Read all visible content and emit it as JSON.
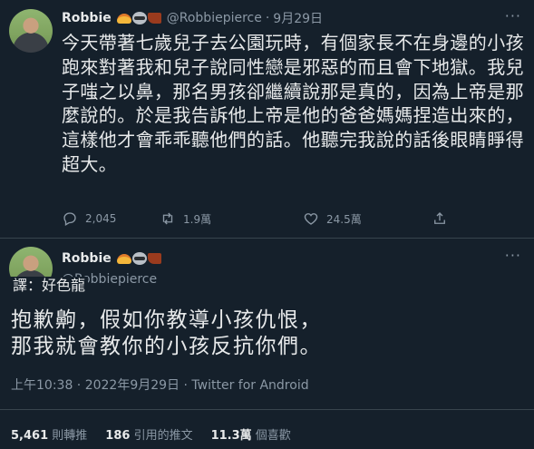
{
  "tweet": {
    "name": "Robbie",
    "handle": "@Robbiepierce",
    "date": "9月29日",
    "text": "今天帶著七歲兒子去公園玩時，有個家長不在身邊的小孩跑來對著我和兒子說同性戀是邪惡的而且會下地獄。我兒子嗤之以鼻，那名男孩卻繼續說那是真的，因為上帝是那麼說的。於是我告訴他上帝是他的爸爸媽媽捏造出來的，這樣他才會乖乖聽他們的話。他聽完我說的話後眼睛睜得超大。",
    "replies": "2,045",
    "retweets": "1.9萬",
    "likes": "24.5萬"
  },
  "reply": {
    "name": "Robbie",
    "handle": "@Robbiepierce",
    "translator": "譯：好色龍",
    "text_line1": "抱歉齁，假如你教導小孩仇恨，",
    "text_line2": "那我就會教你的小孩反抗你們。",
    "timestamp": "上午10:38 · 2022年9月29日 · Twitter for Android",
    "retweets_count": "5,461",
    "retweets_label": "則轉推",
    "quotes_count": "186",
    "quotes_label": "引用的推文",
    "likes_count": "11.3萬",
    "likes_label": "個喜歡"
  },
  "icons": {
    "reply": "reply-icon",
    "retweet": "retweet-icon",
    "like": "heart-icon",
    "share": "share-icon",
    "more": "more-icon",
    "emoji": [
      "taco-emoji",
      "raccoon-emoji",
      "boot-emoji"
    ]
  },
  "colors": {
    "background": "#15202b",
    "text": "#e7e9ea",
    "muted": "#8b98a5",
    "divider": "#38444d"
  }
}
